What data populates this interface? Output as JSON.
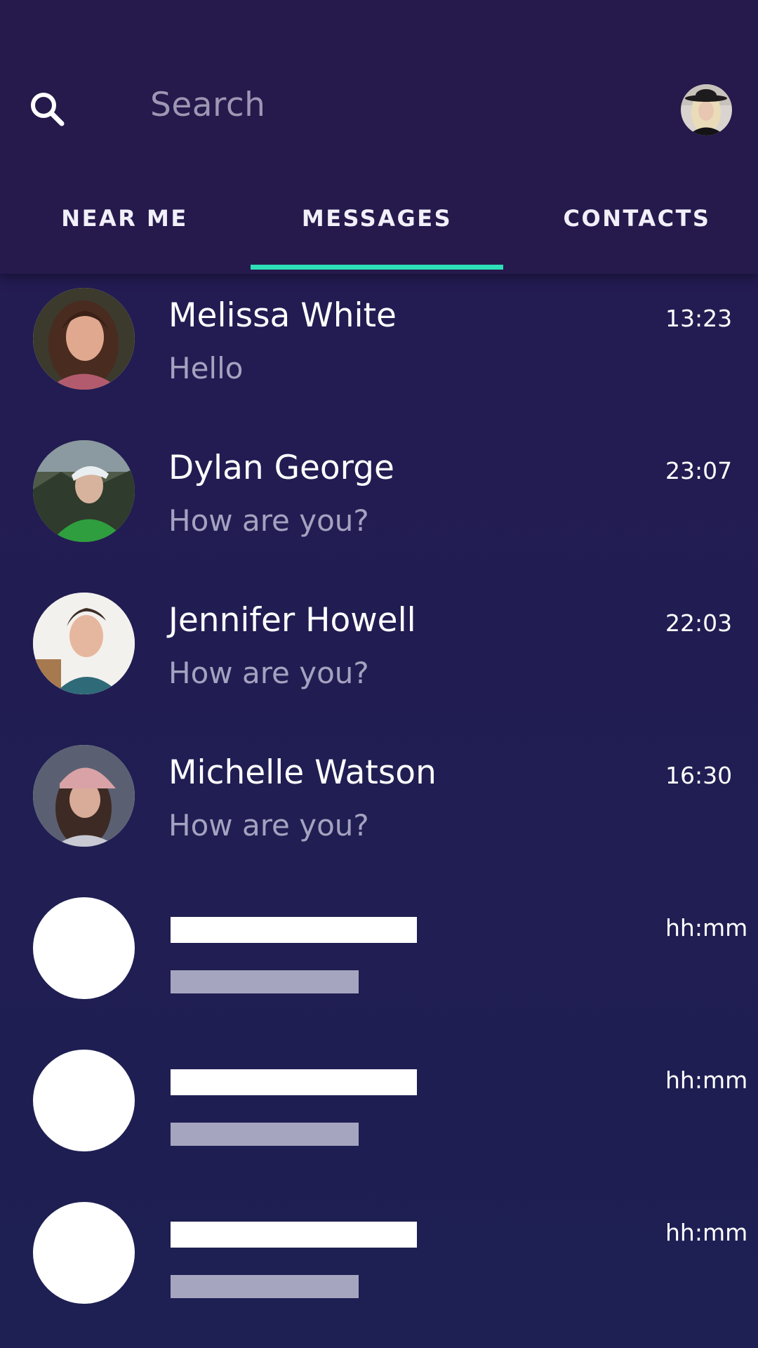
{
  "colors": {
    "header_bg": "#26194c",
    "list_bg": "#211d52",
    "accent": "#2de0b8",
    "muted_text": "#a5a2c0",
    "placeholder_text_bar": "#a6a5bf"
  },
  "header": {
    "search_icon": "search-icon",
    "search_placeholder": "Search",
    "profile_avatar": "profile-photo"
  },
  "tabs": [
    {
      "label": "NEAR ME",
      "active": false
    },
    {
      "label": "MESSAGES",
      "active": true
    },
    {
      "label": "CONTACTS",
      "active": false
    }
  ],
  "conversations": [
    {
      "name": "Melissa White",
      "message": "Hello",
      "time": "13:23",
      "avatar": "photo-woman-curly-hair"
    },
    {
      "name": "Dylan George",
      "message": "How are you?",
      "time": "23:07",
      "avatar": "photo-man-green-jacket"
    },
    {
      "name": "Jennifer Howell",
      "message": "How are you?",
      "time": "22:03",
      "avatar": "photo-woman-short-hair"
    },
    {
      "name": "Michelle Watson",
      "message": "How are you?",
      "time": "16:30",
      "avatar": "photo-woman-pink-cap"
    }
  ],
  "placeholders": [
    {
      "time": "hh:mm"
    },
    {
      "time": "hh:mm"
    },
    {
      "time": "hh:mm"
    }
  ]
}
